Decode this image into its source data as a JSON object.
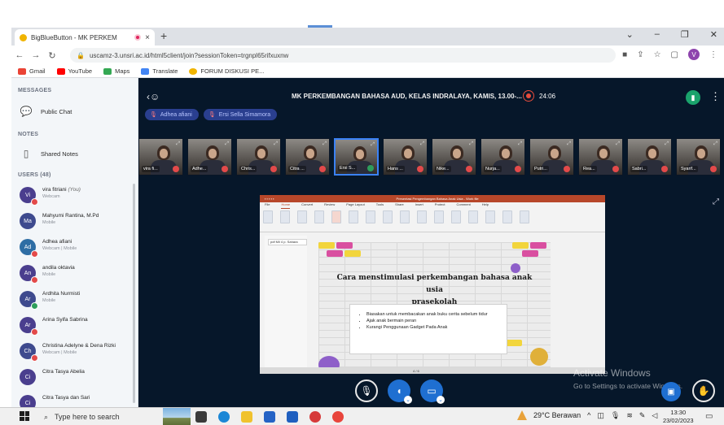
{
  "browser": {
    "tab_title": "BigBlueButton - MK PERKEM",
    "tab_close": "×",
    "new_tab": "+",
    "url": "uscamz-3.unsri.ac.id/html5client/join?sessionToken=trgnpl65rifxuxnw",
    "profile_initial": "V",
    "bookmarks": [
      "Gmail",
      "YouTube",
      "Maps",
      "Translate",
      "FORUM DISKUSI PE..."
    ]
  },
  "sidebar": {
    "messages_title": "MESSAGES",
    "public_chat": "Public Chat",
    "notes_title": "NOTES",
    "shared_notes": "Shared Notes",
    "users_title": "USERS (48)",
    "users": [
      {
        "initials": "Vi",
        "name": "vira fitriani",
        "you": "(You)",
        "sub": "Webcam",
        "color": "#4a3e8e",
        "badge": "red"
      },
      {
        "initials": "Ma",
        "name": "Mahyumi Rantina, M.Pd",
        "you": "",
        "sub": "Mobile",
        "color": "#3e4a8e",
        "badge": ""
      },
      {
        "initials": "Ad",
        "name": "Adhea afiani",
        "you": "",
        "sub": "Webcam | Mobile",
        "color": "#2e6da4",
        "badge": "red"
      },
      {
        "initials": "An",
        "name": "andila oktavia",
        "you": "",
        "sub": "Mobile",
        "color": "#4a3e8e",
        "badge": "red"
      },
      {
        "initials": "Ar",
        "name": "Ardhita Nurmisti",
        "you": "",
        "sub": "Mobile",
        "color": "#3e4a8e",
        "badge": "green"
      },
      {
        "initials": "Ar",
        "name": "Arina Syifa Sabrina",
        "you": "",
        "sub": "",
        "color": "#4a3e8e",
        "badge": "red"
      },
      {
        "initials": "Ch",
        "name": "Christina Adelyne & Dena Rizki",
        "you": "",
        "sub": "Webcam | Mobile",
        "color": "#3e4a8e",
        "badge": "red"
      },
      {
        "initials": "Ci",
        "name": "Citra Tasya Abelia",
        "you": "",
        "sub": "",
        "color": "#4a3e8e",
        "badge": ""
      },
      {
        "initials": "Ci",
        "name": "Citra Tasya dan Sari",
        "you": "",
        "sub": "",
        "color": "#4a3e8e",
        "badge": ""
      }
    ]
  },
  "meeting": {
    "title": "MK PERKEMBANGAN BAHASA AUD, KELAS INDRALAYA, KAMIS, 13.00-...",
    "rec_time": "24:06",
    "talkers": [
      "Adhea afiani",
      "Ersi Sella Simamora"
    ],
    "tiles": [
      {
        "name": "vira fi...",
        "muted": true
      },
      {
        "name": "Adhe...",
        "muted": true
      },
      {
        "name": "Chris...",
        "muted": true
      },
      {
        "name": "Citra ...",
        "muted": true
      },
      {
        "name": "Ersi S...",
        "muted": false
      },
      {
        "name": "Hans ...",
        "muted": true
      },
      {
        "name": "Nike...",
        "muted": true
      },
      {
        "name": "Nurja...",
        "muted": true
      },
      {
        "name": "Putri...",
        "muted": true
      },
      {
        "name": "Rea...",
        "muted": true
      },
      {
        "name": "Sabri...",
        "muted": true
      },
      {
        "name": "Syarif...",
        "muted": true
      }
    ]
  },
  "presentation": {
    "app_title": "Presentasi Pengembangan Bahasa Anak Usia - Work file",
    "tabs": [
      "File",
      "Home",
      "Convert",
      "Review",
      "Page Layout",
      "Tools",
      "Share",
      "Insert",
      "Protect",
      "Comment",
      "Help"
    ],
    "thumb_label": "pdf Mil 4 p. Sahara",
    "slide_title_line1": "Cara menstimulasi perkembangan bahasa anak usia",
    "slide_title_line2": "prasekolah",
    "bullets": [
      "Biasakan untuk membacakan anak buku cerita sebelum tidur",
      "Ajak anak bermain peran",
      "Kurangi Penggunaan Gadget Pada Anak"
    ],
    "status": "4 / 6"
  },
  "watermark": {
    "line1": "Activate Windows",
    "line2": "Go to Settings to activate Windows."
  },
  "taskbar": {
    "search_placeholder": "Type here to search",
    "weather": "29°C Berawan",
    "time": "13:30",
    "date": "23/02/2023"
  }
}
